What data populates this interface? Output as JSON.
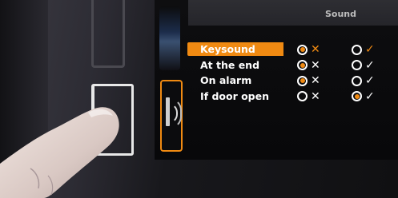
{
  "header": {
    "title": "Sound"
  },
  "icons": {
    "top": "globe-icon",
    "active": "speaker-icon"
  },
  "colors": {
    "accent": "#f08a12",
    "background": "#0a0a0c",
    "text": "#ffffff"
  },
  "settings": [
    {
      "label": "Keysound",
      "highlighted": true,
      "off_selected": true,
      "on_selected": false,
      "off_glyph": "✕",
      "on_glyph": "✓"
    },
    {
      "label": "At the end",
      "highlighted": false,
      "off_selected": true,
      "on_selected": false,
      "off_glyph": "✕",
      "on_glyph": "✓"
    },
    {
      "label": "On alarm",
      "highlighted": false,
      "off_selected": true,
      "on_selected": false,
      "off_glyph": "✕",
      "on_glyph": "✓"
    },
    {
      "label": "If door open",
      "highlighted": false,
      "off_selected": false,
      "on_selected": true,
      "off_glyph": "✕",
      "on_glyph": "✓"
    }
  ]
}
